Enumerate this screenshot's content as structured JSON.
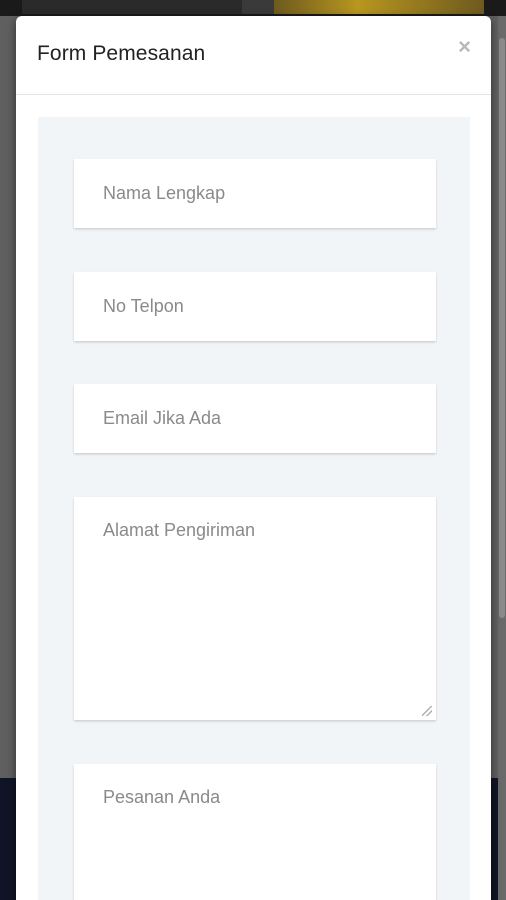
{
  "modal": {
    "title": "Form Pemesanan",
    "close_label": "×"
  },
  "form": {
    "nama_placeholder": "Nama Lengkap",
    "telpon_placeholder": "No Telpon",
    "email_placeholder": "Email Jika Ada",
    "alamat_placeholder": "Alamat Pengiriman",
    "pesan_placeholder": "Pesanan Anda"
  },
  "colors": {
    "panel_background": "#f2f5f8",
    "placeholder_text": "#8a8a8a",
    "backdrop_bottom": "#0f1526"
  }
}
